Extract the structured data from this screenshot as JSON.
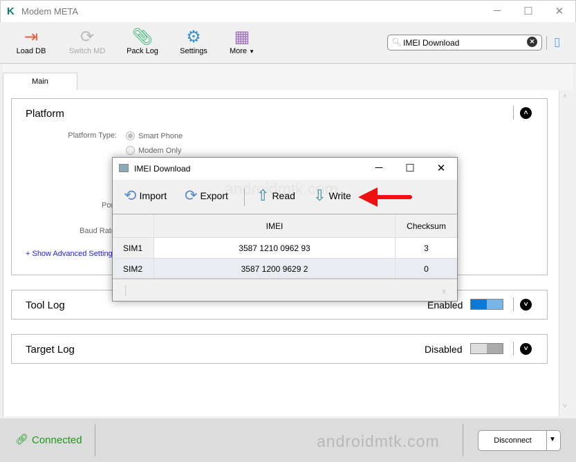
{
  "app": {
    "title": "Modem META",
    "accent": "#0078d7"
  },
  "toolbar": {
    "items": [
      {
        "label": "Load DB",
        "icon": "load-db-icon",
        "color": "#e06040"
      },
      {
        "label": "Switch MD",
        "icon": "switch-icon",
        "color": "#bbbbbb",
        "disabled": true
      },
      {
        "label": "Pack Log",
        "icon": "paperclip-icon",
        "color": "#3cb878"
      },
      {
        "label": "Settings",
        "icon": "gear-icon",
        "color": "#3a8fd0"
      },
      {
        "label": "More",
        "icon": "grid-icon",
        "color": "#a070c0"
      }
    ],
    "search": {
      "value": "IMEI Download"
    }
  },
  "tabs": [
    {
      "label": "Main",
      "active": true
    }
  ],
  "platform": {
    "title": "Platform",
    "platform_type_label": "Platform Type:",
    "options": [
      "Smart Phone",
      "Modem Only"
    ],
    "selected": "Smart Phone",
    "port_label": "Por",
    "baud_label": "Baud Rate",
    "advanced_link": "+ Show Advanced Setting"
  },
  "tool_log": {
    "title": "Tool Log",
    "state": "Enabled"
  },
  "target_log": {
    "title": "Target Log",
    "state": "Disabled"
  },
  "status": {
    "connection": "Connected",
    "connection_color": "#1a9a1a",
    "disconnect": "Disconnect",
    "watermark": "androidmtk.com"
  },
  "dialog": {
    "title": "IMEI Download",
    "watermark": "androidmtk.com",
    "buttons": [
      {
        "label": "Import"
      },
      {
        "label": "Export"
      },
      {
        "label": "Read"
      },
      {
        "label": "Write"
      }
    ],
    "columns": [
      "",
      "IMEI",
      "Checksum"
    ],
    "rows": [
      [
        "SIM1",
        "3587 1210 0962 93",
        "3"
      ],
      [
        "SIM2",
        "3587 1200 9629 2",
        "0"
      ]
    ]
  }
}
